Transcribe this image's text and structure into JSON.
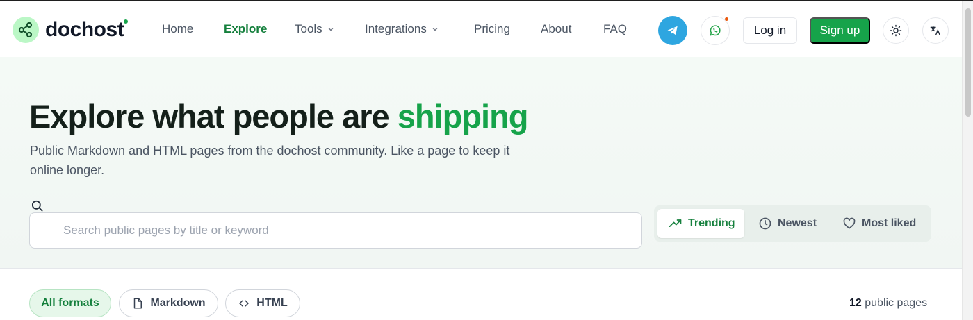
{
  "brand": {
    "name": "dochost",
    "accent_color": "#16a34a"
  },
  "nav": {
    "items": [
      {
        "label": "Home"
      },
      {
        "label": "Explore"
      },
      {
        "label": "Tools"
      },
      {
        "label": "Integrations"
      },
      {
        "label": "Pricing"
      },
      {
        "label": "About"
      },
      {
        "label": "FAQ"
      }
    ],
    "active": "Explore"
  },
  "header_actions": {
    "telegram_icon": "telegram-icon",
    "whatsapp_icon": "whatsapp-icon",
    "login_label": "Log in",
    "signup_label": "Sign up",
    "theme_icon": "sun-icon",
    "language_icon": "translate-icon"
  },
  "hero": {
    "title_prefix": "Explore what people are ",
    "title_accent": "shipping",
    "subtitle": "Public Markdown and HTML pages from the dochost community. Like a page to keep it online longer."
  },
  "search": {
    "placeholder": "Search public pages by title or keyword",
    "value": ""
  },
  "sort": {
    "options": [
      {
        "label": "Trending",
        "icon": "trending-up-icon"
      },
      {
        "label": "Newest",
        "icon": "clock-icon"
      },
      {
        "label": "Most liked",
        "icon": "heart-icon"
      }
    ],
    "selected": "Trending"
  },
  "filters": {
    "formats": [
      {
        "label": "All formats"
      },
      {
        "label": "Markdown",
        "icon": "file-icon"
      },
      {
        "label": "HTML",
        "icon": "code-icon"
      }
    ],
    "selected": "All formats"
  },
  "results": {
    "count": "12",
    "suffix": "public pages"
  }
}
